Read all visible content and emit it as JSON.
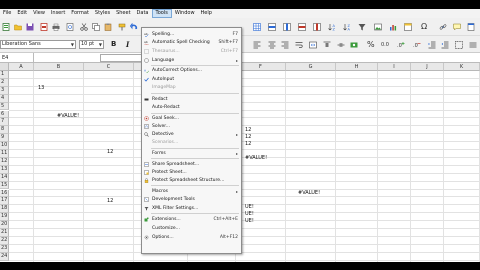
{
  "menubar": [
    "File",
    "Edit",
    "View",
    "Insert",
    "Format",
    "Styles",
    "Sheet",
    "Data",
    "Tools",
    "Window",
    "Help"
  ],
  "active_menu": "Tools",
  "toolbar": {
    "font_name": "Liberation Sans",
    "font_size": "10 pt",
    "bold": "B",
    "italic": "I",
    "percent": "%",
    "decimal": "0.0",
    "omega": "Ω"
  },
  "formula_bar": {
    "name_box": "E4"
  },
  "columns": [
    "A",
    "B",
    "C",
    "D",
    "E",
    "F",
    "G",
    "H",
    "I",
    "J",
    "K",
    "L",
    "M",
    "N"
  ],
  "rows": [
    "1",
    "2",
    "3",
    "4",
    "5",
    "6",
    "7",
    "8",
    "9",
    "10",
    "11",
    "12",
    "13",
    "14",
    "15",
    "16",
    "17",
    "18",
    "19",
    "20",
    "21",
    "22",
    "23",
    "24"
  ],
  "cells": {
    "a1": "13",
    "b5": "#VALUE!",
    "c11": "12",
    "c19": "12",
    "e8": "12",
    "e9": "12",
    "e10": "12",
    "e12": "#VALUE!",
    "e19": "UE!",
    "e20": "UE!",
    "e21": "UE!",
    "h18": "#VALUE!"
  },
  "tools_menu": {
    "spelling": "Spelling...",
    "spelling_sc": "F7",
    "auto_spell": "Automatic Spell Checking",
    "auto_spell_sc": "Shift+F7",
    "thesaurus": "Thesaurus...",
    "thesaurus_sc": "Ctrl+F7",
    "language": "Language",
    "autocorrect": "AutoCorrect Options...",
    "autoinput": "AutoInput",
    "image_map": "ImageMap",
    "redact": "Redact",
    "auto_redact": "Auto-Redact",
    "goal_seek": "Goal Seek...",
    "solver": "Solver...",
    "detective": "Detective",
    "scenarios": "Scenarios...",
    "forms": "Forms",
    "share": "Share Spreadsheet...",
    "protect_sheet": "Protect Sheet...",
    "protect_structure": "Protect Spreadsheet Structure...",
    "macros": "Macros",
    "dev_tools": "Development Tools",
    "xml_filter": "XML Filter Settings...",
    "extensions": "Extensions...",
    "extensions_sc": "Ctrl+Alt+E",
    "customize": "Customize...",
    "options": "Options...",
    "options_sc": "Alt+F12"
  },
  "colors": {
    "menu_highlight": "#cfe3f6",
    "check_blue": "#2d6bd6",
    "error_red": "#c0392b"
  }
}
